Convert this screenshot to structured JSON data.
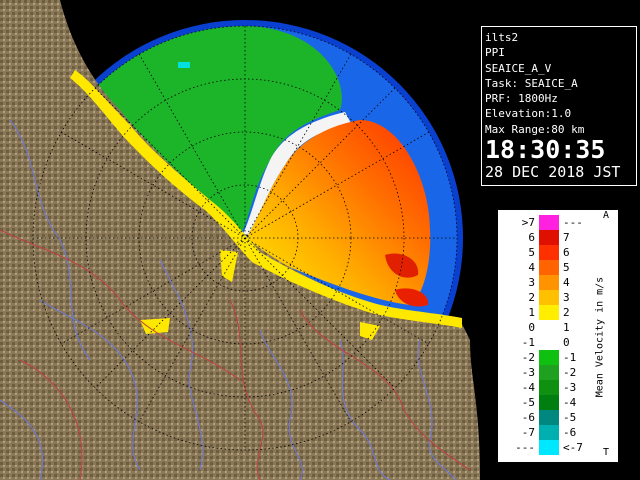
{
  "info": {
    "site": "ilts2",
    "product": "PPI",
    "dataset": "SEAICE_A_V",
    "task": "Task: SEAICE_A",
    "prf": "PRF: 1800Hz",
    "elevation": "Elevation:1.0",
    "max_range": "Max Range:80 km",
    "time": "18:30:35",
    "date": "28 DEC 2018 JST"
  },
  "legend": {
    "title": "Mean Velocity in m/s",
    "corner_top": "A",
    "corner_bottom": "T",
    "rows": [
      {
        "left": ">7",
        "right": "---",
        "color": "#ff20e0"
      },
      {
        "left": "6",
        "right": "7",
        "color": "#e01000"
      },
      {
        "left": "5",
        "right": "6",
        "color": "#ff3000"
      },
      {
        "left": "4",
        "right": "5",
        "color": "#ff6400"
      },
      {
        "left": "3",
        "right": "4",
        "color": "#ff9400"
      },
      {
        "left": "2",
        "right": "3",
        "color": "#ffc000"
      },
      {
        "left": "1",
        "right": "2",
        "color": "#ffee00"
      },
      {
        "left": "0",
        "right": "1",
        "color": "#ffffff"
      },
      {
        "left": "-1",
        "right": "0",
        "color": "#ffffff"
      },
      {
        "left": "-2",
        "right": "-1",
        "color": "#10c010"
      },
      {
        "left": "-3",
        "right": "-2",
        "color": "#20a020"
      },
      {
        "left": "-4",
        "right": "-3",
        "color": "#109010"
      },
      {
        "left": "-5",
        "right": "-4",
        "color": "#007e10"
      },
      {
        "left": "-6",
        "right": "-5",
        "color": "#008880"
      },
      {
        "left": "-7",
        "right": "-6",
        "color": "#00b0b0"
      },
      {
        "left": "---",
        "right": "<-7",
        "color": "#00e8ff"
      }
    ]
  },
  "colors": {
    "ocean_blue": "#1a64e6",
    "ring_blue": "#0a3ec8",
    "terrain": "#8a7a5a",
    "river": "#6a7ad8",
    "boundary": "#c04040"
  }
}
